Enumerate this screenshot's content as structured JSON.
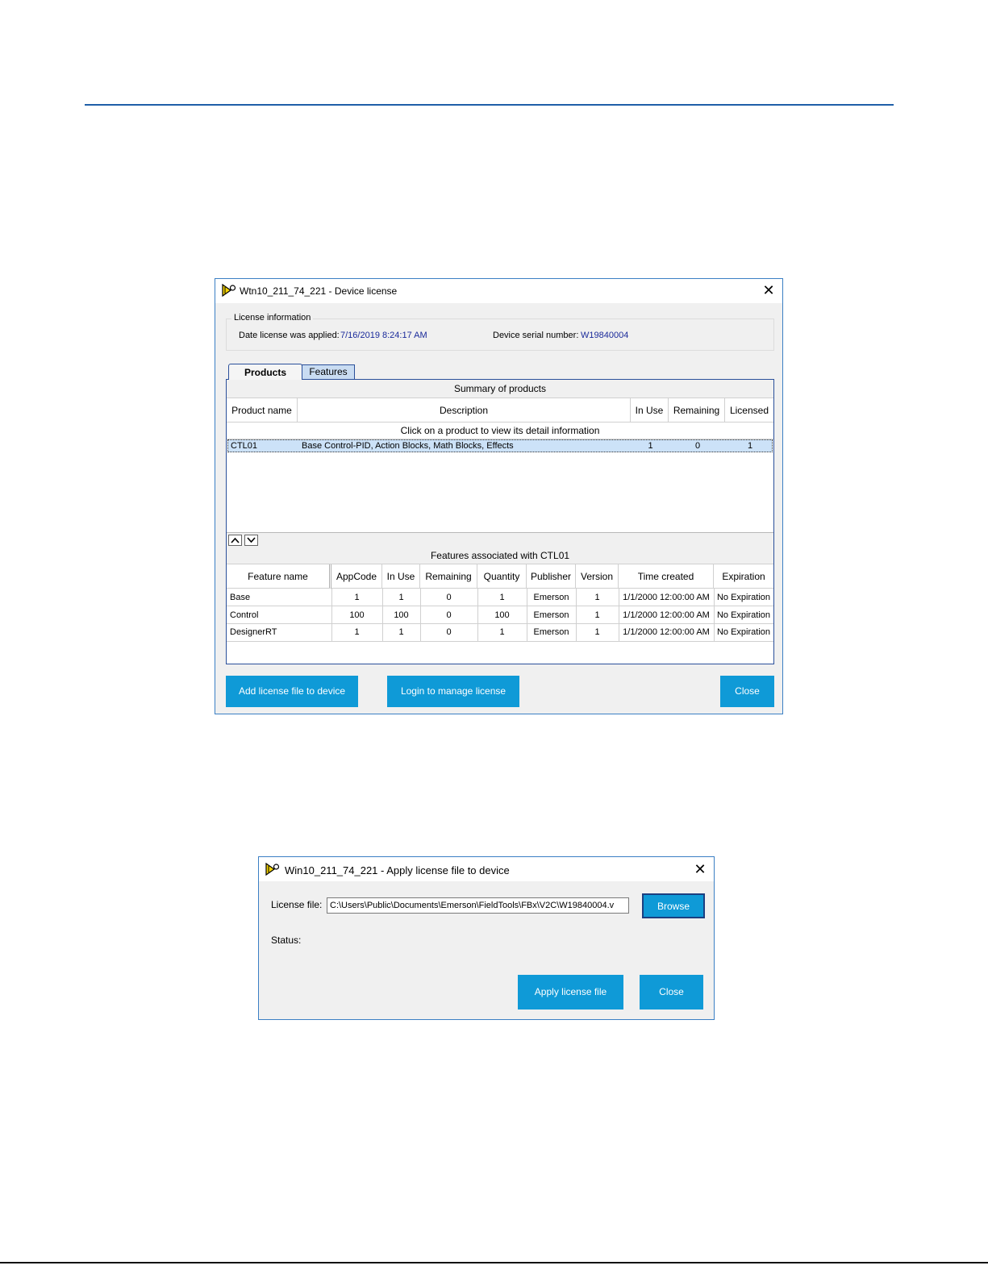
{
  "device_license": {
    "title": "Wtn10_211_74_221 - Device license",
    "license_info": {
      "legend": "License information",
      "date_label": "Date license was applied:",
      "date_value": "7/16/2019 8:24:17 AM",
      "serial_label": "Device serial number:",
      "serial_value": "W19840004"
    },
    "tabs": [
      "Products",
      "Features"
    ],
    "products": {
      "caption": "Summary of products",
      "columns": [
        "Product name",
        "Description",
        "In Use",
        "Remaining",
        "Licensed"
      ],
      "hint": "Click on a product to view its detail information",
      "rows": [
        [
          "CTL01",
          "Base Control-PID, Action Blocks, Math Blocks, Effects",
          "1",
          "0",
          "1"
        ]
      ]
    },
    "features": {
      "caption": "Features associated with CTL01",
      "columns": [
        "Feature name",
        "AppCode",
        "In Use",
        "Remaining",
        "Quantity",
        "Publisher",
        "Version",
        "Time created",
        "Expiration"
      ],
      "rows": [
        [
          "Base",
          "1",
          "1",
          "0",
          "1",
          "Emerson",
          "1",
          "1/1/2000 12:00:00 AM",
          "No Expiration"
        ],
        [
          "Control",
          "100",
          "100",
          "0",
          "100",
          "Emerson",
          "1",
          "1/1/2000 12:00:00 AM",
          "No Expiration"
        ],
        [
          "DesignerRT",
          "1",
          "1",
          "0",
          "1",
          "Emerson",
          "1",
          "1/1/2000 12:00:00 AM",
          "No Expiration"
        ]
      ]
    },
    "buttons": {
      "add": "Add license file to device",
      "login": "Login to manage license",
      "close": "Close"
    }
  },
  "apply_license": {
    "title": "Win10_211_74_221 - Apply license file to device",
    "license_file_label": "License file:",
    "license_file_value": "C:\\Users\\Public\\Documents\\Emerson\\FieldTools\\FBx\\V2C\\W19840004.v",
    "browse_label": "Browse",
    "status_label": "Status:",
    "apply_label": "Apply license file",
    "close_label": "Close"
  },
  "colors": {
    "accent_button": "#0f9ad7",
    "window_border": "#3b7fc4",
    "rule": "#1f5fa8",
    "value_text": "#1a2a9a"
  },
  "icons": [
    "app-icon",
    "close-icon",
    "chevron-up-icon",
    "chevron-down-icon"
  ]
}
